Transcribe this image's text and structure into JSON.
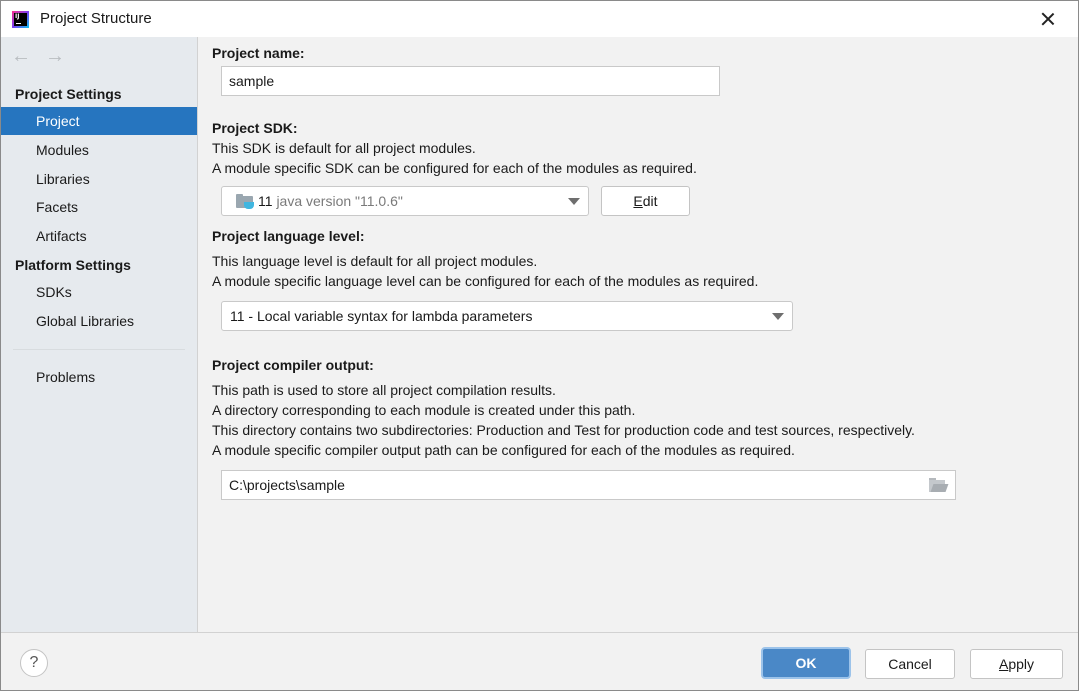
{
  "window": {
    "title": "Project Structure",
    "app_icon": "intellij-idea-icon",
    "close_icon": "close-icon"
  },
  "sidebar": {
    "back_icon": "←",
    "forward_icon": "→",
    "sections": [
      {
        "header": "Project Settings",
        "items": [
          {
            "label": "Project",
            "selected": true
          },
          {
            "label": "Modules",
            "selected": false
          },
          {
            "label": "Libraries",
            "selected": false
          },
          {
            "label": "Facets",
            "selected": false
          },
          {
            "label": "Artifacts",
            "selected": false
          }
        ]
      },
      {
        "header": "Platform Settings",
        "items": [
          {
            "label": "SDKs",
            "selected": false
          },
          {
            "label": "Global Libraries",
            "selected": false
          }
        ]
      }
    ],
    "problems": "Problems"
  },
  "main": {
    "project_name": {
      "label": "Project name:",
      "value": "sample"
    },
    "project_sdk": {
      "label": "Project SDK:",
      "desc1": "This SDK is default for all project modules.",
      "desc2": "A module specific SDK can be configured for each of the modules as required.",
      "selected_name": "11",
      "selected_version": "java version \"11.0.6\"",
      "edit_button_mnemonic": "E",
      "edit_button_rest": "dit"
    },
    "language_level": {
      "label": "Project language level:",
      "desc1": "This language level is default for all project modules.",
      "desc2": "A module specific language level can be configured for each of the modules as required.",
      "selected": "11 - Local variable syntax for lambda parameters"
    },
    "compiler_output": {
      "label": "Project compiler output:",
      "desc1": "This path is used to store all project compilation results.",
      "desc2": "A directory corresponding to each module is created under this path.",
      "desc3": "This directory contains two subdirectories: Production and Test for production code and test sources, respectively.",
      "desc4": "A module specific compiler output path can be configured for each of the modules as required.",
      "value": "C:\\projects\\sample"
    }
  },
  "footer": {
    "help": "?",
    "ok": "OK",
    "cancel": "Cancel",
    "apply_mnemonic": "A",
    "apply_rest": "pply"
  }
}
